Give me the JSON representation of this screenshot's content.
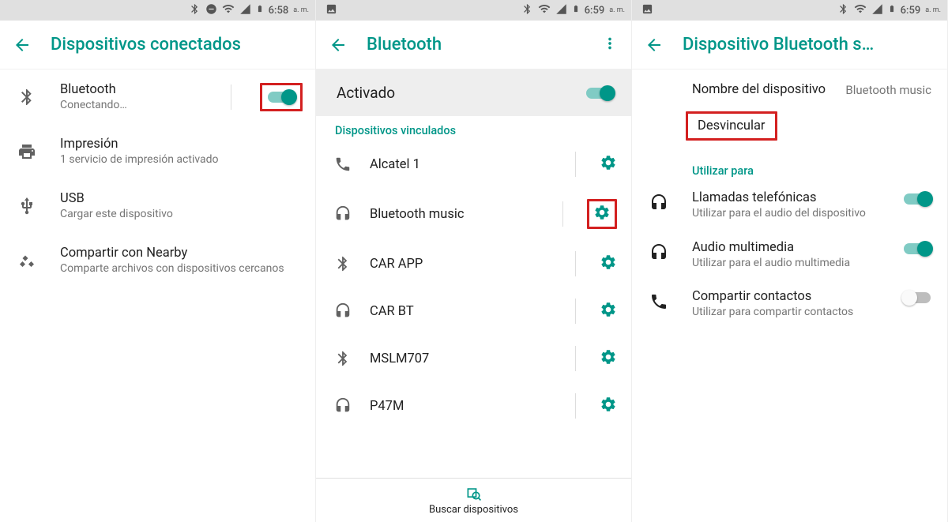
{
  "accent": "#009688",
  "red": "#d32020",
  "screens": {
    "s1": {
      "status": {
        "time": "6:58",
        "ampm": "a. m.",
        "showImage": false,
        "showDnd": true,
        "showBt": true
      },
      "title": "Dispositivos conectados",
      "items": [
        {
          "icon": "bluetooth",
          "primary": "Bluetooth",
          "secondary": "Conectando…",
          "toggle": true
        },
        {
          "icon": "print",
          "primary": "Impresión",
          "secondary": "1 servicio de impresión activado"
        },
        {
          "icon": "usb",
          "primary": "USB",
          "secondary": "Cargar este dispositivo"
        },
        {
          "icon": "nearby",
          "primary": "Compartir con Nearby",
          "secondary": "Comparte archivos con dispositivos cercanos"
        }
      ]
    },
    "s2": {
      "status": {
        "time": "6:59",
        "ampm": "a. m.",
        "showImage": true,
        "showDnd": false,
        "showBt": true
      },
      "title": "Bluetooth",
      "activeLabel": "Activado",
      "sectionHeader": "Dispositivos vinculados",
      "devices": [
        {
          "icon": "phone",
          "name": "Alcatel 1"
        },
        {
          "icon": "headphones",
          "name": "Bluetooth music",
          "highlight": true
        },
        {
          "icon": "bluetooth",
          "name": "CAR APP"
        },
        {
          "icon": "headphones",
          "name": "CAR BT"
        },
        {
          "icon": "bluetooth",
          "name": "MSLM707"
        },
        {
          "icon": "headphones",
          "name": "P47M"
        }
      ],
      "searchLabel": "Buscar dispositivos"
    },
    "s3": {
      "status": {
        "time": "6:59",
        "ampm": "a. m.",
        "showImage": true,
        "showDnd": false,
        "showBt": true
      },
      "title": "Dispositivo Bluetooth s…",
      "nameLabel": "Nombre del dispositivo",
      "nameValue": "Bluetooth music",
      "unpair": "Desvincular",
      "useHeader": "Utilizar para",
      "uses": [
        {
          "icon": "headphones",
          "primary": "Llamadas telefónicas",
          "secondary": "Utilizar para el audio del dispositivo",
          "on": true
        },
        {
          "icon": "headphones",
          "primary": "Audio multimedia",
          "secondary": "Utilizar para el audio multimedia",
          "on": true
        },
        {
          "icon": "phone",
          "primary": "Compartir contactos",
          "secondary": "Utilizar para compartir contactos",
          "on": false
        }
      ]
    }
  }
}
